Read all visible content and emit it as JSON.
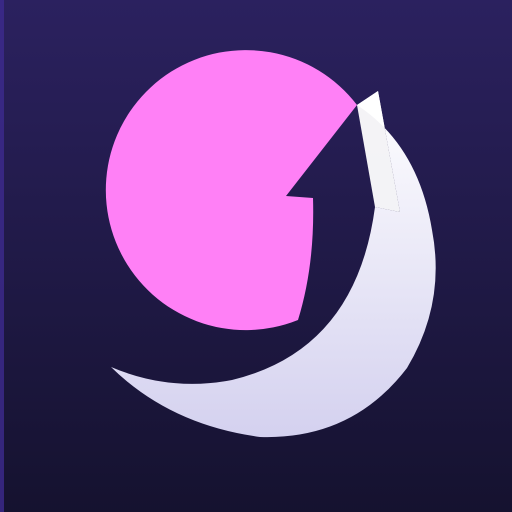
{
  "icon": {
    "name": "app-icon",
    "semantic": "upward-arrow-moon-icon"
  },
  "colors": {
    "background_top": "#2b215f",
    "background_bottom": "#15122f",
    "edge_accent": "#3d2a8f",
    "circle_magenta": "#ff80f6",
    "crescent_top": "#ffffff",
    "crescent_bottom": "#d4d1ef"
  }
}
